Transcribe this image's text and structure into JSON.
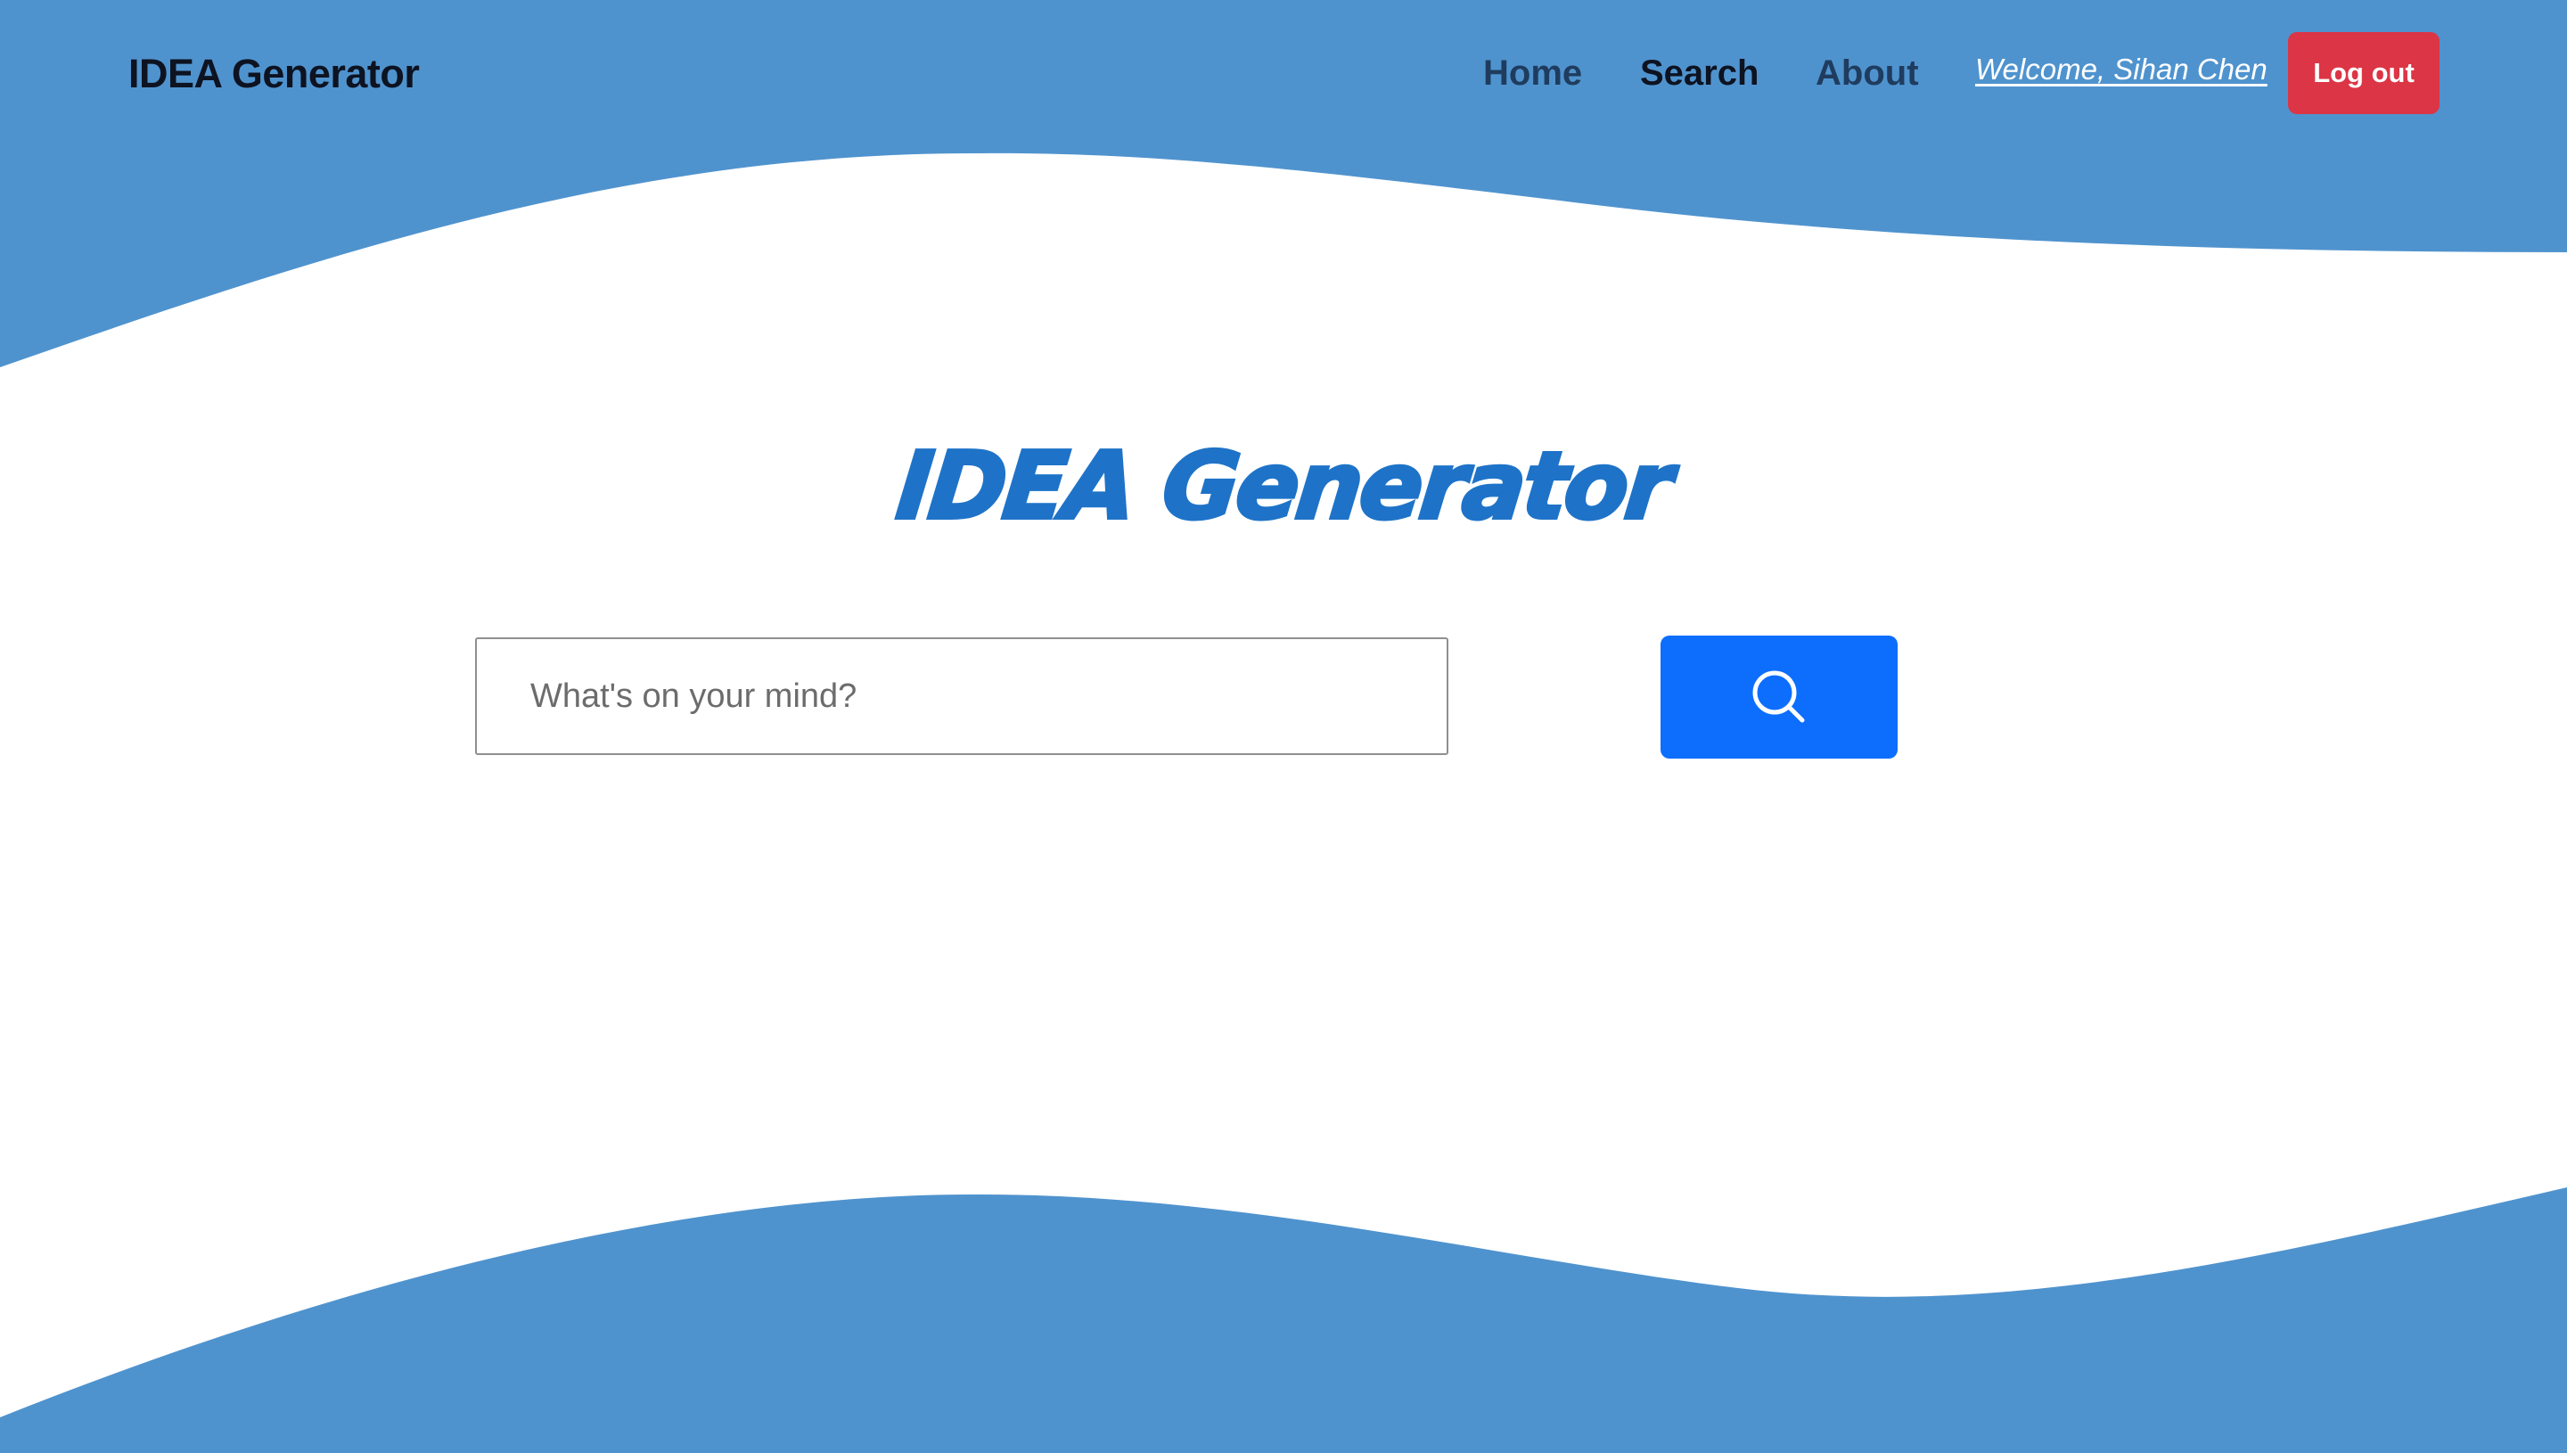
{
  "colors": {
    "wave_blue": "#4f93ce",
    "hero_title": "#1e73c8",
    "primary_button": "#0d6efd",
    "danger_button": "#dc3545",
    "brand_text": "#0d1321",
    "nav_text": "#1f3c5e"
  },
  "navbar": {
    "brand": "IDEA Generator",
    "links": [
      {
        "label": "Home"
      },
      {
        "label": "Search"
      },
      {
        "label": "About"
      }
    ],
    "welcome": "Welcome, Sihan Chen",
    "logout_label": "Log out"
  },
  "hero": {
    "title": "IDEA Generator"
  },
  "search": {
    "placeholder": "What's on your mind?",
    "value": "",
    "button_icon": "search-icon"
  }
}
